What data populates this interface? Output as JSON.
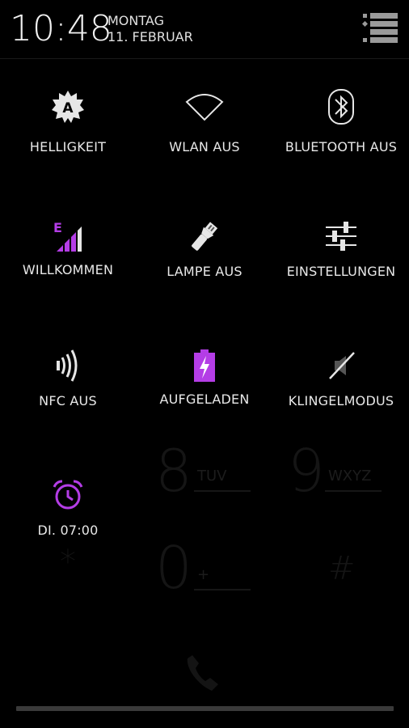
{
  "status": {
    "time": "10:48",
    "day": "MONTAG",
    "date": "11. FEBRUAR"
  },
  "tiles": [
    {
      "label": "HELLIGKEIT",
      "icon": "brightness-auto-icon"
    },
    {
      "label": "WLAN AUS",
      "icon": "wifi-icon"
    },
    {
      "label": "BLUETOOTH AUS",
      "icon": "bluetooth-icon"
    },
    {
      "label": "WILLKOMMEN",
      "icon": "mobile-signal-icon",
      "badge": "E"
    },
    {
      "label": "LAMPE AUS",
      "icon": "flashlight-icon"
    },
    {
      "label": "EINSTELLUNGEN",
      "icon": "settings-sliders-icon"
    },
    {
      "label": "NFC AUS",
      "icon": "nfc-icon"
    },
    {
      "label": "AUFGELADEN",
      "icon": "battery-charged-icon"
    },
    {
      "label": "KLINGELMODUS",
      "icon": "ringer-muted-icon"
    },
    {
      "label": "DI. 07:00",
      "icon": "alarm-icon"
    }
  ],
  "background_dialer": {
    "keys": [
      {
        "digit": "8",
        "letters": "TUV"
      },
      {
        "digit": "9",
        "letters": "WXYZ"
      },
      {
        "digit": "*",
        "letters": ""
      },
      {
        "digit": "0",
        "letters": "+"
      },
      {
        "digit": "#",
        "letters": ""
      }
    ]
  },
  "colors": {
    "accent": "#b43de6",
    "icon": "#e6e6e6",
    "background": "#000000"
  }
}
